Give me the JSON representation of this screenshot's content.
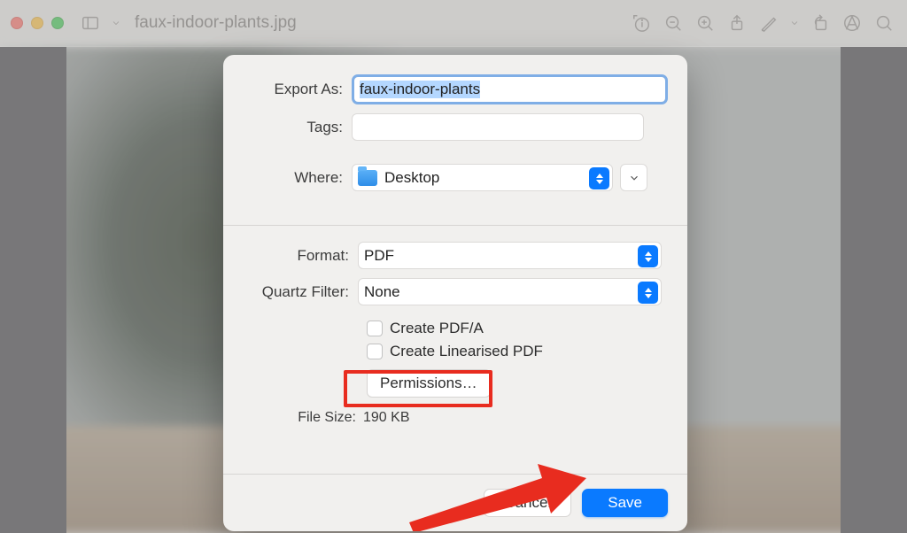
{
  "toolbar": {
    "title": "faux-indoor-plants.jpg"
  },
  "dialog": {
    "export_as_label": "Export As:",
    "export_as_value": "faux-indoor-plants",
    "tags_label": "Tags:",
    "tags_value": "",
    "where_label": "Where:",
    "where_value": "Desktop",
    "format_label": "Format:",
    "format_value": "PDF",
    "quartz_label": "Quartz Filter:",
    "quartz_value": "None",
    "create_pdfa_label": "Create PDF/A",
    "create_linearised_label": "Create Linearised PDF",
    "permissions_label": "Permissions…",
    "file_size_label": "File Size:",
    "file_size_value": "190 KB",
    "cancel_label": "Cancel",
    "save_label": "Save"
  }
}
